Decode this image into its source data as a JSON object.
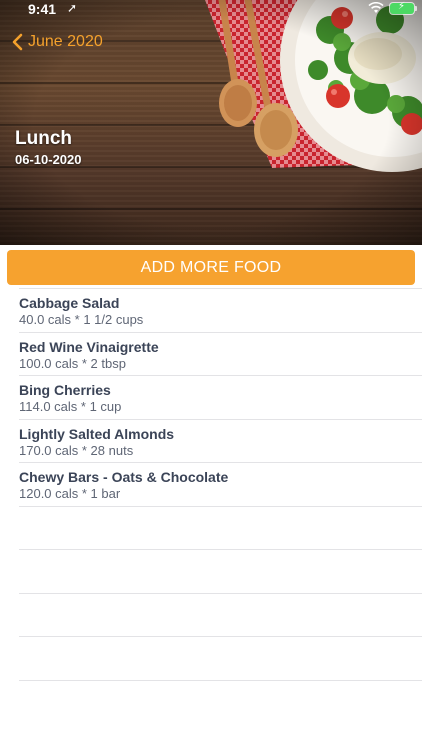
{
  "status_bar": {
    "time": "9:41"
  },
  "nav": {
    "back_label": "June 2020"
  },
  "meal": {
    "title": "Lunch",
    "date": "06-10-2020"
  },
  "actions": {
    "add_food_label": "ADD MORE FOOD"
  },
  "food_items": [
    {
      "name": "Cabbage Salad",
      "detail": "40.0 cals * 1 1/2 cups"
    },
    {
      "name": "Red Wine Vinaigrette",
      "detail": "100.0 cals * 2 tbsp"
    },
    {
      "name": "Bing Cherries",
      "detail": "114.0 cals * 1 cup"
    },
    {
      "name": "Lightly Salted Almonds",
      "detail": "170.0 cals * 28 nuts"
    },
    {
      "name": "Chewy Bars - Oats & Chocolate",
      "detail": "120.0 cals * 1 bar"
    }
  ],
  "colors": {
    "accent": "#f6a22f",
    "back_link": "#f4a12c",
    "item_name": "#3b4457",
    "item_detail": "#5f6675"
  },
  "icons": {
    "back": "chevron-left-icon",
    "location": "location-arrow-icon",
    "wifi": "wifi-icon",
    "battery": "battery-icon"
  }
}
